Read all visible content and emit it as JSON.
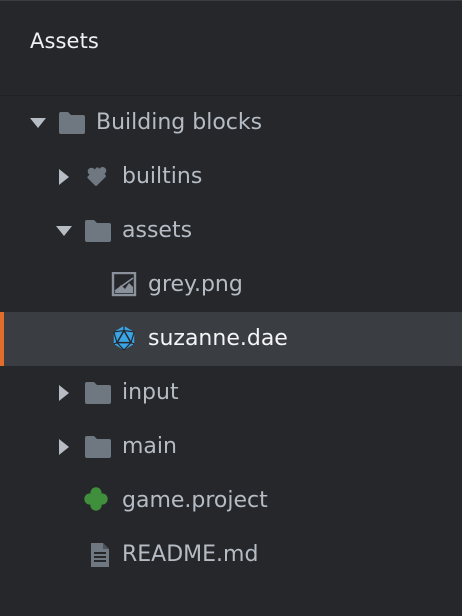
{
  "panel": {
    "title": "Assets"
  },
  "tree": [
    {
      "label": "Building blocks",
      "icon": "folder-icon",
      "expanded": true
    },
    {
      "label": "builtins",
      "icon": "puzzle-piece-icon",
      "expanded": false
    },
    {
      "label": "assets",
      "icon": "folder-icon",
      "expanded": true
    },
    {
      "label": "grey.png",
      "icon": "image-file-icon"
    },
    {
      "label": "suzanne.dae",
      "icon": "collada-model-icon",
      "selected": true
    },
    {
      "label": "input",
      "icon": "folder-icon",
      "expanded": false
    },
    {
      "label": "main",
      "icon": "folder-icon",
      "expanded": false
    },
    {
      "label": "game.project",
      "icon": "game-project-icon"
    },
    {
      "label": "README.md",
      "icon": "document-file-icon"
    }
  ],
  "colors": {
    "background": "#25272b",
    "selected_row": "#3a3d42",
    "selection_accent": "#e06d2c",
    "text": "#b6bcc4",
    "folder": "#6f7781",
    "model_icon": "#3ba4e4",
    "project_icon": "#3f8f3c"
  }
}
